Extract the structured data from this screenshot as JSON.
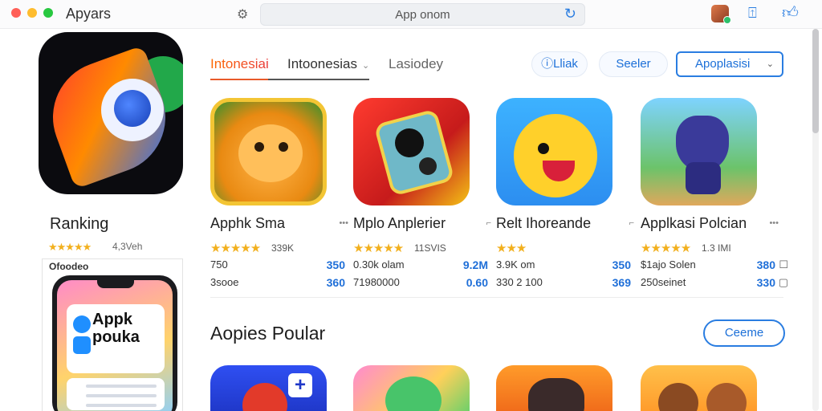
{
  "window": {
    "title": "Apyars",
    "address": "App onom",
    "colors": {
      "accent": "#2a7de1",
      "star": "#f2b01e"
    }
  },
  "feature": {
    "heading": "Ranking",
    "stars": "★★★★★",
    "meta": "4,3Veh",
    "card_label": "Ofoodeo",
    "phone_title_1": "Appk",
    "phone_title_2": "pouka"
  },
  "tabs": {
    "tab1": "Intonesiai",
    "tab2": "Intoonesias",
    "tab3": "Lasiodey"
  },
  "buttons": {
    "lliak": "Lliak",
    "seeler": "Seeler",
    "apps": "Apoplasisi",
    "more": "Ceeme"
  },
  "apps": [
    {
      "name": "Apphk Sma",
      "stars": "★★★★★",
      "count": "339K",
      "row1_left": "750",
      "row1_right": "350",
      "row2_left": "3sooe",
      "row2_right": "360"
    },
    {
      "name": "Mplo Anplerier",
      "stars": "★★★★★",
      "count": "11SVIS",
      "row1_left": "0.30k olam",
      "row1_right": "9.2M",
      "row2_left": "71980000",
      "row2_right": "0.60"
    },
    {
      "name": "Relt Ihoreande",
      "stars": "★★★",
      "count": "",
      "row1_left": "3.9K om",
      "row1_right": "350",
      "row2_left": "330 2 100",
      "row2_right": "369"
    },
    {
      "name": "Applkasi Polcian",
      "stars": "★★★★★",
      "count": "1.3 IMI",
      "row1_left": "$1ajo Solen",
      "row1_right": "380",
      "row2_left": "250seinet",
      "row2_right": "330"
    }
  ],
  "section": {
    "title": "Aopies Poular"
  },
  "icons": [
    "gear-icon",
    "reload-icon",
    "avatar",
    "share-icon",
    "thumbs-up-icon"
  ]
}
